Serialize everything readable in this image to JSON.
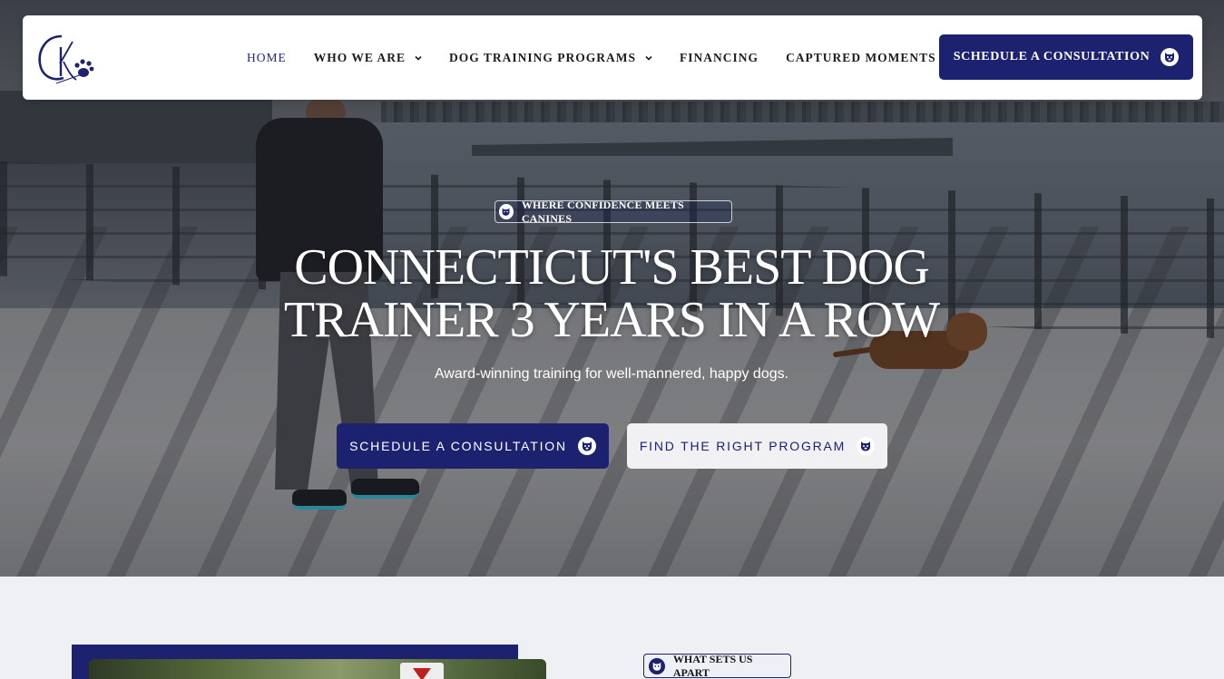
{
  "colors": {
    "brand": "#1c2270",
    "white": "#ffffff",
    "text_dark": "#1b1c1e"
  },
  "nav": {
    "logo_icon": "ck-paw-logo-icon",
    "items": [
      {
        "label": "HOME",
        "active": true,
        "has_dropdown": false
      },
      {
        "label": "WHO WE ARE",
        "active": false,
        "has_dropdown": true
      },
      {
        "label": "DOG TRAINING PROGRAMS",
        "active": false,
        "has_dropdown": true
      },
      {
        "label": "FINANCING",
        "active": false,
        "has_dropdown": false
      },
      {
        "label": "CAPTURED MOMENTS",
        "active": false,
        "has_dropdown": false
      }
    ],
    "cta_label": "SCHEDULE A CONSULTATION",
    "cta_icon": "dog-face-icon"
  },
  "hero": {
    "tagline": "WHERE CONFIDENCE MEETS CANINES",
    "headline_line1": "CONNECTICUT'S BEST DOG",
    "headline_line2": "TRAINER 3 YEARS IN A ROW",
    "subheading": "Award-winning training for well-mannered, happy dogs.",
    "primary_button": "SCHEDULE A CONSULTATION",
    "secondary_button": "FIND THE RIGHT PROGRAM"
  },
  "section": {
    "tag": "WHAT SETS US APART"
  }
}
